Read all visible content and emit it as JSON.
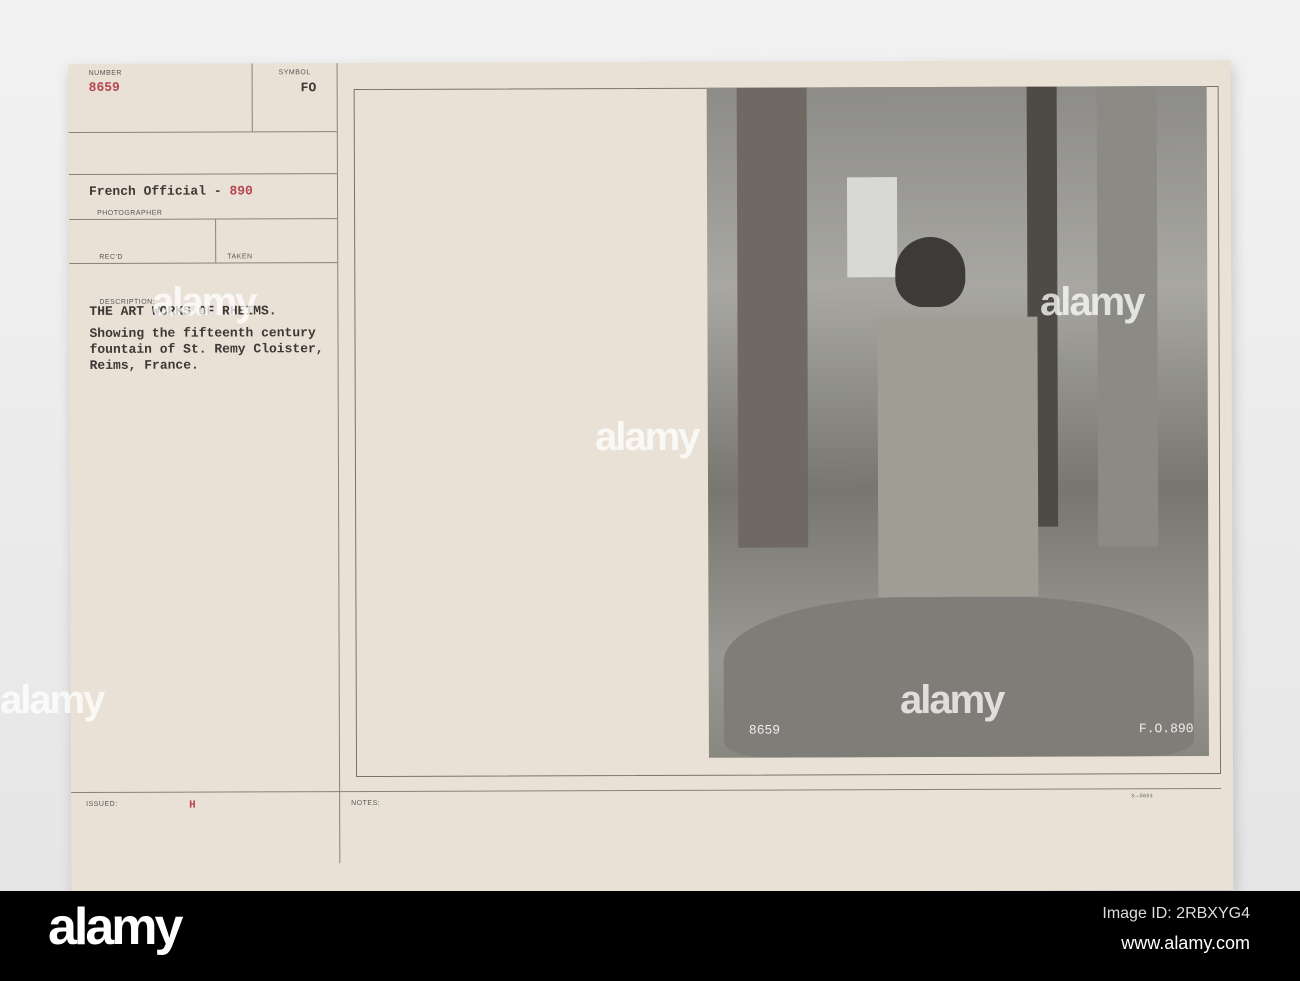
{
  "card": {
    "number_label": "NUMBER",
    "number": "8659",
    "symbol_label": "SYMBOL",
    "symbol": "FO",
    "photographer": "French Official - ",
    "photographer_num": "890",
    "photographer_label": "PHOTOGRAPHER",
    "recd_label": "REC'D",
    "taken_label": "TAKEN",
    "description_label": "DESCRIPTION:",
    "description_title": "THE ART WORKS OF RHEIMS.",
    "description_lines": [
      "Showing the fifteenth century",
      "fountain of St. Remy Cloister,",
      "Reims, France."
    ],
    "issued_label": "ISSUED:",
    "issued_value": "H",
    "notes_label": "NOTES:",
    "form_code": "3—5603"
  },
  "photo": {
    "caption_left": "8659",
    "caption_right": "F.O.890"
  },
  "watermark": {
    "text": "alamy",
    "image_id": "Image ID: 2RBXYG4",
    "url": "www.alamy.com"
  }
}
